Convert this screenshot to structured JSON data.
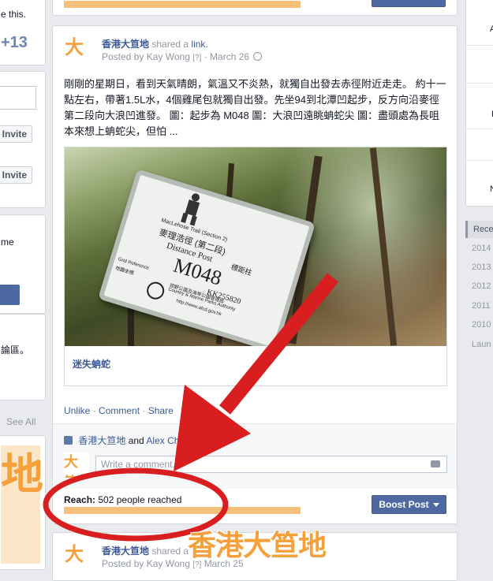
{
  "left_column": {
    "partial_text_top": "e this.",
    "plus_count": "+13",
    "invite_label_1": "Invite",
    "invite_label_2": "Invite",
    "partial_text_me": "me",
    "partial_text_forum": "論區。",
    "see_all": "See All"
  },
  "post": {
    "page_name": "香港大笪地",
    "action_text": "shared a",
    "action_link": "link.",
    "posted_by_prefix": "Posted by",
    "author": "Kay Wong",
    "author_marker": "[?]",
    "separator": "·",
    "date": "March 26",
    "body": "剛剛的星期日，看到天氣晴朗，氣溫又不炎熱，就獨自出發去赤徑附近走走。 約十一點左右，帶著1.5L水，4個雞尾包就獨自出發。先坐94到北潭凹起步，反方向沿麥徑第二段向大浪凹進發。 圖：起步為 M048 圖：大浪凹遠眺蚺蛇尖 圖：盡頭處為長咀本來想上蚺蛇尖，但怕 ...",
    "link_title": "迷失蚺蛇",
    "photo_sign": {
      "trail_en": "MacLehose Trail (Section 2)",
      "trail_zh": "麥理浩徑 (第二段)",
      "post_label_en": "Distance Post",
      "post_label_zh": "標距柱",
      "post_code": "M048",
      "grid_ref_code": "KK255820",
      "grid_ref_en": "Grid Reference",
      "grid_ref_zh": "地圖坐標",
      "dept_en": "Country & Marine Parks Authority",
      "dept_zh": "郊野公園及海岸公園管理局",
      "url": "http://www.afcd.gov.hk"
    },
    "actions": {
      "unlike": "Unlike",
      "comment": "Comment",
      "share": "Share",
      "dot": "·"
    },
    "likes": {
      "name1": "香港大笪地",
      "and": "and",
      "name2": "Alex Chang"
    },
    "comment_placeholder": "Write a comment...",
    "reach_label": "Reach:",
    "reach_text": "502 people reached",
    "boost_label": "Boost Post"
  },
  "next_post": {
    "page_name": "香港大笪地",
    "action_text": "shared a",
    "posted_by_prefix": "Posted by",
    "author": "Kay Wong",
    "author_marker": "[?]",
    "date": "March 25"
  },
  "right_column": {
    "partial_a": "A",
    "partial_f": "F",
    "partial_n": "N",
    "recent_header": "Rece",
    "years": [
      "2014",
      "2013",
      "2012",
      "2011",
      "2010",
      "Laun"
    ]
  },
  "annotation": {
    "watermark": "香港大笪地",
    "arrow_color": "#d81e1e",
    "oval_color": "#d81e1e"
  },
  "colors": {
    "link": "#3b5998",
    "reach_bar": "#f6c07a",
    "button_blue": "#4e69a2",
    "logo_orange": "#f5a03a"
  }
}
